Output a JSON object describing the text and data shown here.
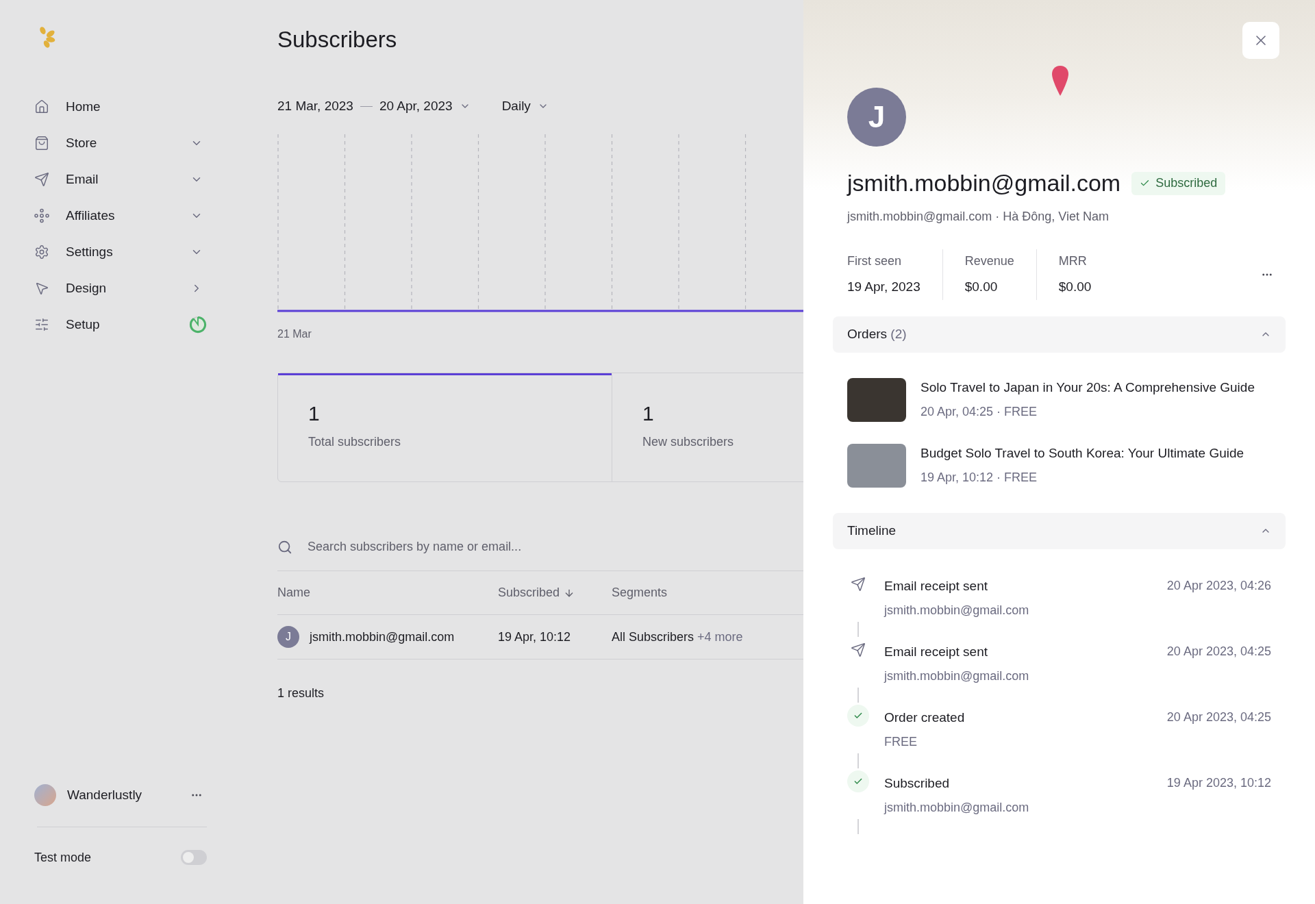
{
  "sidebar": {
    "items": [
      {
        "label": "Home",
        "kind": "plain"
      },
      {
        "label": "Store",
        "kind": "group"
      },
      {
        "label": "Email",
        "kind": "group"
      },
      {
        "label": "Affiliates",
        "kind": "group"
      },
      {
        "label": "Settings",
        "kind": "group"
      },
      {
        "label": "Design",
        "kind": "link"
      },
      {
        "label": "Setup",
        "kind": "progress"
      }
    ],
    "user": {
      "name": "Wanderlustly"
    },
    "test_mode": {
      "label": "Test mode",
      "on": false
    }
  },
  "main": {
    "title": "Subscribers",
    "date_range": {
      "start": "21 Mar, 2023",
      "end": "20 Apr, 2023"
    },
    "interval": "Daily",
    "chart": {
      "x_label": "21 Mar"
    },
    "stats": [
      {
        "value": "1",
        "label": "Total subscribers",
        "selected": true
      },
      {
        "value": "1",
        "label": "New subscribers",
        "selected": false
      }
    ],
    "search": {
      "placeholder": "Search subscribers by name or email..."
    },
    "table": {
      "columns": [
        {
          "label": "Name",
          "sorted": false
        },
        {
          "label": "Subscribed",
          "sorted": true
        },
        {
          "label": "Segments",
          "sorted": false
        }
      ],
      "rows": [
        {
          "initial": "J",
          "email": "jsmith.mobbin@gmail.com",
          "subscribed": "19 Apr, 10:12",
          "segment": "All Subscribers",
          "more": "+4 more"
        }
      ]
    },
    "results": "1 results"
  },
  "panel": {
    "initial": "J",
    "email": "jsmith.mobbin@gmail.com",
    "status": "Subscribed",
    "subtitle": "jsmith.mobbin@gmail.com · Hà Đông, Viet Nam",
    "stats": [
      {
        "label": "First seen",
        "value": "19 Apr, 2023"
      },
      {
        "label": "Revenue",
        "value": "$0.00"
      },
      {
        "label": "MRR",
        "value": "$0.00"
      }
    ],
    "orders": {
      "title": "Orders",
      "count": "(2)",
      "expanded": true,
      "items": [
        {
          "title": "Solo Travel to Japan in Your 20s: A Comprehensive Guide",
          "meta": "20 Apr, 04:25 · FREE"
        },
        {
          "title": "Budget Solo Travel to South Korea: Your Ultimate Guide",
          "meta": "19 Apr, 10:12 · FREE"
        }
      ]
    },
    "timeline": {
      "title": "Timeline",
      "expanded": true,
      "events": [
        {
          "kind": "email",
          "title": "Email receipt sent",
          "detail": "jsmith.mobbin@gmail.com",
          "time": "20 Apr 2023, 04:26"
        },
        {
          "kind": "email",
          "title": "Email receipt sent",
          "detail": "jsmith.mobbin@gmail.com",
          "time": "20 Apr 2023, 04:25"
        },
        {
          "kind": "check",
          "title": "Order created",
          "detail": "FREE",
          "time": "20 Apr 2023, 04:25"
        },
        {
          "kind": "check",
          "title": "Subscribed",
          "detail": "jsmith.mobbin@gmail.com",
          "time": "19 Apr 2023, 10:12"
        }
      ]
    }
  }
}
